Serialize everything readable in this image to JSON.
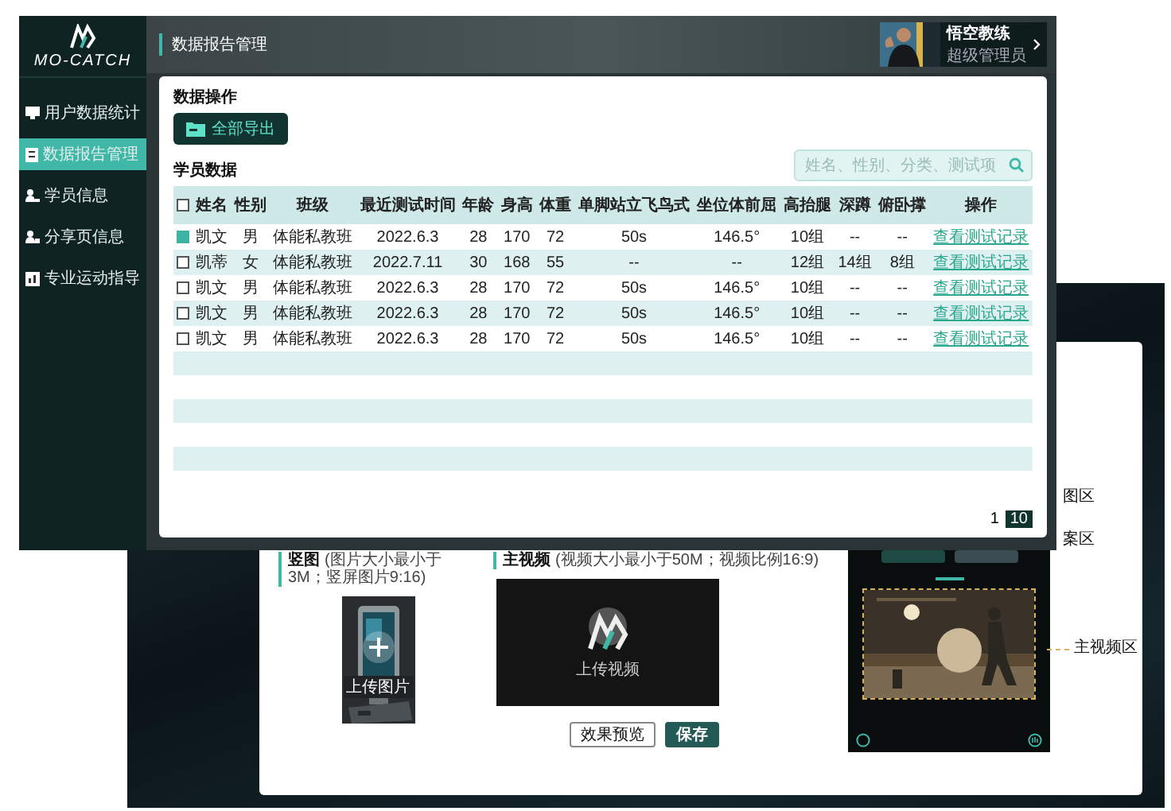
{
  "front": {
    "brand": "MO-CATCH",
    "sidebar": [
      {
        "label": "用户数据统计",
        "selected": false
      },
      {
        "label": "数据报告管理",
        "selected": true
      },
      {
        "label": "学员信息",
        "selected": false
      },
      {
        "label": "分享页信息",
        "selected": false
      },
      {
        "label": "专业运动指导",
        "selected": false
      }
    ],
    "header_title": "数据报告管理",
    "user": {
      "name": "悟空教练",
      "role": "超级管理员"
    },
    "operations": {
      "title": "数据操作",
      "export_button": "全部导出"
    },
    "data_title": "学员数据",
    "search": {
      "placeholder": "姓名、性别、分类、测试项"
    },
    "table": {
      "all_checked": false,
      "columns": [
        "姓名",
        "性别",
        "班级",
        "最近测试时间",
        "年龄",
        "身高",
        "体重",
        "单脚站立飞鸟式",
        "坐位体前屈",
        "高抬腿",
        "深蹲",
        "俯卧撑",
        "操作"
      ],
      "rows": [
        {
          "checked": true,
          "cells": [
            "凯文",
            "男",
            "体能私教班",
            "2022.6.3",
            "28",
            "170",
            "72",
            "50s",
            "146.5°",
            "10组",
            "--",
            "--"
          ],
          "action": "查看测试记录"
        },
        {
          "checked": false,
          "cells": [
            "凯蒂",
            "女",
            "体能私教班",
            "2022.7.11",
            "30",
            "168",
            "55",
            "--",
            "--",
            "12组",
            "14组",
            "8组"
          ],
          "action": "查看测试记录"
        },
        {
          "checked": false,
          "cells": [
            "凯文",
            "男",
            "体能私教班",
            "2022.6.3",
            "28",
            "170",
            "72",
            "50s",
            "146.5°",
            "10组",
            "--",
            "--"
          ],
          "action": "查看测试记录"
        },
        {
          "checked": false,
          "cells": [
            "凯文",
            "男",
            "体能私教班",
            "2022.6.3",
            "28",
            "170",
            "72",
            "50s",
            "146.5°",
            "10组",
            "--",
            "--"
          ],
          "action": "查看测试记录"
        },
        {
          "checked": false,
          "cells": [
            "凯文",
            "男",
            "体能私教班",
            "2022.6.3",
            "28",
            "170",
            "72",
            "50s",
            "146.5°",
            "10组",
            "--",
            "--"
          ],
          "action": "查看测试记录"
        }
      ]
    },
    "pagination": {
      "page": "1",
      "page_size": "10"
    }
  },
  "back": {
    "area_labels": [
      "图区",
      "案区"
    ],
    "main_video_label": "主视频区",
    "uploads": [
      {
        "title": "竖图",
        "hint": "(图片大小最小于3M；竖屏图片9:16)",
        "upload_label": "上传图片"
      },
      {
        "kind": "video",
        "title": "主视频",
        "hint": "(视频大小最小于50M；视频比例16:9)",
        "upload_label": "上传视频"
      }
    ],
    "buttons": [
      {
        "kind": "secondary",
        "label": "效果预览"
      },
      {
        "kind": "primary",
        "label": "保存"
      }
    ]
  }
}
